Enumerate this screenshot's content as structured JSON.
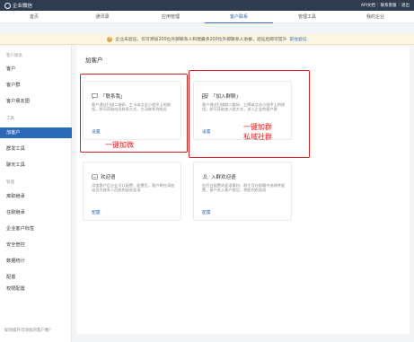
{
  "topbar": {
    "app_name": "企业微信",
    "links": [
      "API文档",
      "联系客服",
      "退出"
    ]
  },
  "nav": {
    "items": [
      {
        "label": "首页"
      },
      {
        "label": "通讯录"
      },
      {
        "label": "应用管理"
      },
      {
        "label": "客户联系"
      },
      {
        "label": "管理工具"
      },
      {
        "label": "我的企业"
      }
    ],
    "active_index": 3
  },
  "notice": {
    "text": "企业未验证，仅可添加200位外部联系人和建最多200位外部联系人进群，验证后即可提升",
    "link": "前往验证"
  },
  "sidebar": {
    "group1_title": "客户联系",
    "group1_items": [
      "客户",
      "客户群",
      "客户朋友圈"
    ],
    "group2_title": "工具",
    "group2_items": [
      "加客户",
      "群发工具",
      "聊天工具"
    ],
    "group3_title": "管理",
    "group3_items": [
      "离职继承",
      "在职继承",
      "企业客户标签",
      "安全管控",
      "数据统计",
      "配置",
      "权限配置"
    ],
    "active_item": "加客户",
    "footer": "如何提升可添加的客户数？"
  },
  "main": {
    "title": "加客户",
    "cards": [
      {
        "title": "「联系我」",
        "desc": "客户通过扫描二维码、工卡或点击小程序上的按钮，即可获取成员联系方式，主动联系到成员",
        "action": "设置"
      },
      {
        "title": "「加入群聊」",
        "desc": "客户通过扫描群二维码、立牌或点击小程序上的按钮，即可获取加入群方式，进入企业的客户群",
        "action": "设置"
      },
      {
        "title": "欢迎语",
        "desc": "添加客户后企业可以配置、配置后，客户将在添加成员为联系人后收到该欢迎语",
        "action": "配置"
      },
      {
        "title": "入群欢迎语",
        "desc": "在后台配置欢迎语素材，群主可在群聊中选择并配置，客户进入客户群后，将收到欢迎语",
        "action": "配置"
      }
    ]
  },
  "annotations": {
    "left_label": "一键加微",
    "right_label_line1": "一键加群",
    "right_label_line2": "私域社群",
    "color": "#e02020"
  }
}
